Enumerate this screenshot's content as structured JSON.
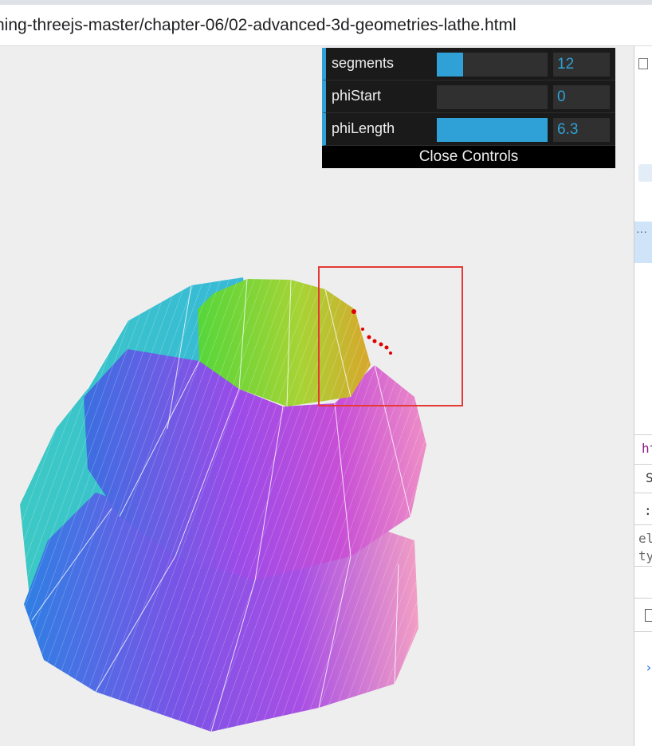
{
  "address_bar": {
    "url": "ning-threejs-master/chapter-06/02-advanced-3d-geometries-lathe.html"
  },
  "controls": {
    "rows": [
      {
        "label": "segments",
        "value": "12",
        "fill": 0.24
      },
      {
        "label": "phiStart",
        "value": "0",
        "fill": 0
      },
      {
        "label": "phiLength",
        "value": "6.3",
        "fill": 1.0
      }
    ],
    "close_label": "Close Controls",
    "accent_color": "#2fa1d6"
  },
  "devtools": {
    "more_label": "···",
    "snippets": [
      "ht",
      "S",
      ":",
      "el",
      "ty",
      "›"
    ]
  },
  "colors": {
    "selection_box": "#e53935",
    "points": "#e00000"
  }
}
